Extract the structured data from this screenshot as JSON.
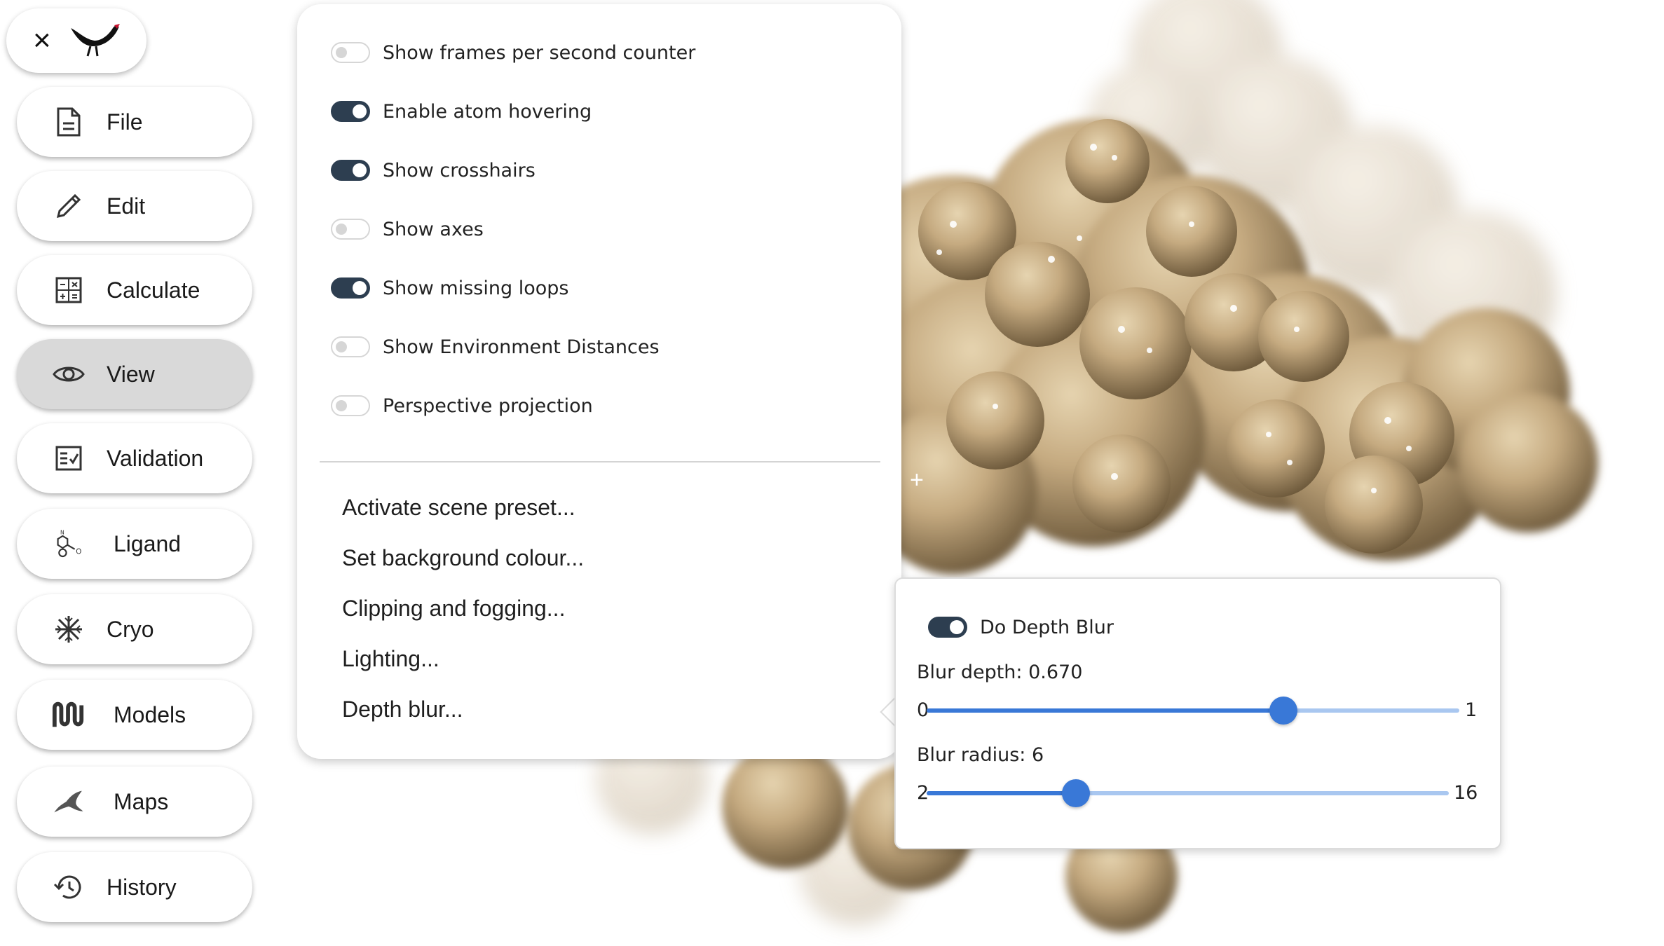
{
  "logo": {
    "close_glyph": "×",
    "brand_icon": "bird-logo-icon"
  },
  "sidebar": {
    "items": [
      {
        "label": "File",
        "icon": "file-icon",
        "active": false
      },
      {
        "label": "Edit",
        "icon": "pencil-icon",
        "active": false
      },
      {
        "label": "Calculate",
        "icon": "calculator-icon",
        "active": false
      },
      {
        "label": "View",
        "icon": "eye-icon",
        "active": true
      },
      {
        "label": "Validation",
        "icon": "checklist-icon",
        "active": false
      },
      {
        "label": "Ligand",
        "icon": "molecule-icon",
        "active": false
      },
      {
        "label": "Cryo",
        "icon": "snowflake-icon",
        "active": false
      },
      {
        "label": "Models",
        "icon": "models-icon",
        "active": false
      },
      {
        "label": "Maps",
        "icon": "maps-icon",
        "active": false
      },
      {
        "label": "History",
        "icon": "history-icon",
        "active": false
      }
    ]
  },
  "view_menu": {
    "toggles": [
      {
        "label": "Show frames per second counter",
        "on": false
      },
      {
        "label": "Enable atom hovering",
        "on": true
      },
      {
        "label": "Show crosshairs",
        "on": true
      },
      {
        "label": "Show axes",
        "on": false
      },
      {
        "label": "Show missing loops",
        "on": true
      },
      {
        "label": "Show Environment Distances",
        "on": false
      },
      {
        "label": "Perspective projection",
        "on": false
      }
    ],
    "items": [
      "Activate scene preset...",
      "Set background colour...",
      "Clipping and fogging...",
      "Lighting...",
      "Depth blur..."
    ]
  },
  "depth_blur": {
    "toggle_label": "Do Depth Blur",
    "toggle_on": true,
    "blur_depth": {
      "label": "Blur depth: 0.670",
      "value": 0.67,
      "min": 0,
      "max": 1,
      "min_label": "0",
      "max_label": "1"
    },
    "blur_radius": {
      "label": "Blur radius: 6",
      "value": 6,
      "min": 2,
      "max": 16,
      "min_label": "2",
      "max_label": "16"
    }
  },
  "scene": {
    "crosshair_glyph": "+",
    "surface_color": "#c8ae86"
  }
}
